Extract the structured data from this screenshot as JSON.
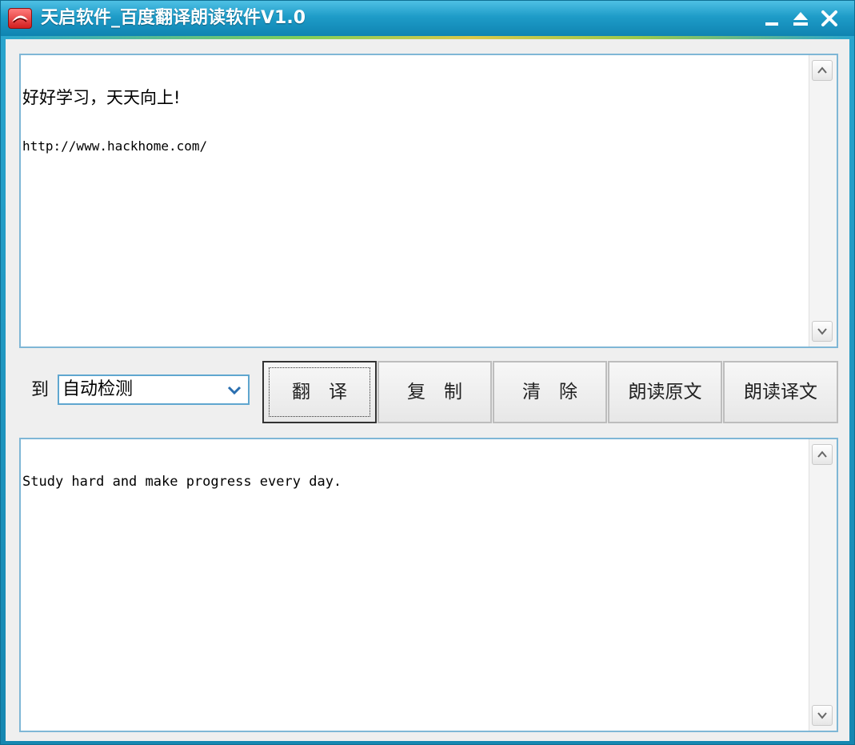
{
  "window": {
    "title": "天启软件_百度翻译朗读软件V1.0",
    "icons": [
      "app-icon",
      "minimize-icon",
      "restore-icon",
      "close-icon"
    ]
  },
  "source": {
    "line1": "好好学习，天天向上!",
    "line2": "http://www.hackhome.com/"
  },
  "controls": {
    "to_label": "到",
    "target_language": "自动检测",
    "buttons": {
      "translate": "翻　译",
      "copy": "复　制",
      "clear": "清　除",
      "read_source": "朗读原文",
      "read_translation": "朗读译文"
    }
  },
  "output": {
    "text": "Study hard and make progress every day."
  },
  "colors": {
    "titlebar": "#1e9cc8",
    "client_bg": "#efefef",
    "input_border": "#7fb7d6"
  }
}
